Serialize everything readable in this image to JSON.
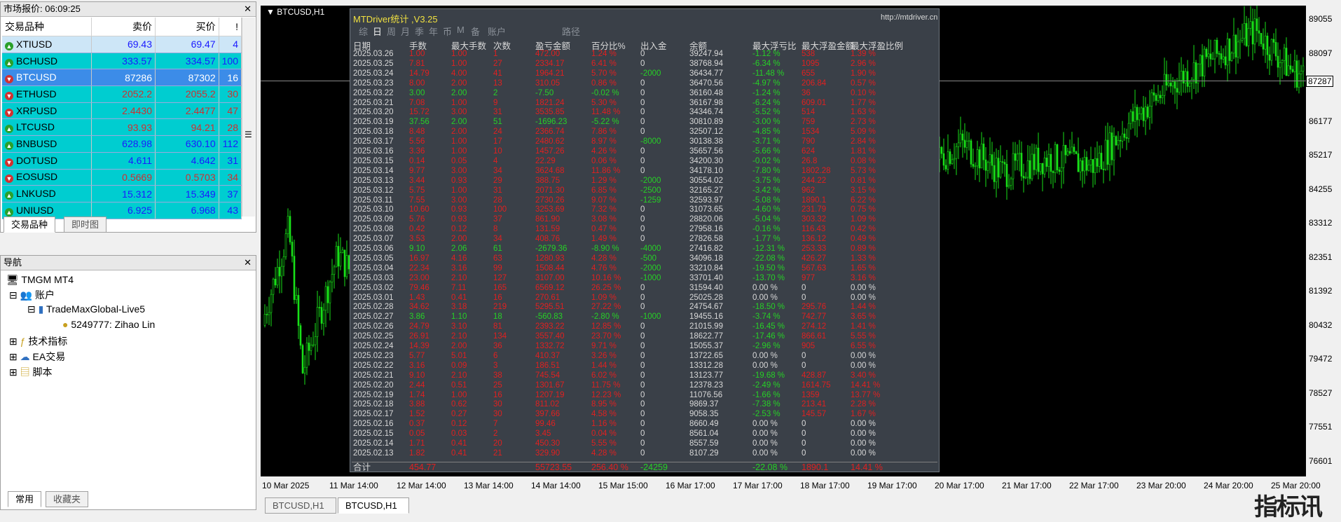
{
  "market_watch": {
    "title": "市场报价: 06:09:25",
    "headers": {
      "symbol": "交易品种",
      "bid": "卖价",
      "ask": "买价",
      "spread": "!"
    },
    "rows": [
      {
        "dir": "up",
        "symbol": "XTIUSD",
        "bid": "69.43",
        "ask": "69.47",
        "spread": "4",
        "color": "#1a1aff"
      },
      {
        "dir": "up",
        "symbol": "BCHUSD",
        "bid": "333.57",
        "ask": "334.57",
        "spread": "100",
        "color": "#1a1aff"
      },
      {
        "dir": "dn",
        "symbol": "BTCUSD",
        "bid": "87286",
        "ask": "87302",
        "spread": "16",
        "color": "#ffffff"
      },
      {
        "dir": "dn",
        "symbol": "ETHUSD",
        "bid": "2052.2",
        "ask": "2055.2",
        "spread": "30",
        "color": "#d03030"
      },
      {
        "dir": "dn",
        "symbol": "XRPUSD",
        "bid": "2.4430",
        "ask": "2.4477",
        "spread": "47",
        "color": "#d03030"
      },
      {
        "dir": "up",
        "symbol": "LTCUSD",
        "bid": "93.93",
        "ask": "94.21",
        "spread": "28",
        "color": "#d03030"
      },
      {
        "dir": "up",
        "symbol": "BNBUSD",
        "bid": "628.98",
        "ask": "630.10",
        "spread": "112",
        "color": "#1a1aff"
      },
      {
        "dir": "dn",
        "symbol": "DOTUSD",
        "bid": "4.611",
        "ask": "4.642",
        "spread": "31",
        "color": "#1a1aff"
      },
      {
        "dir": "dn",
        "symbol": "EOSUSD",
        "bid": "0.5669",
        "ask": "0.5703",
        "spread": "34",
        "color": "#d03030"
      },
      {
        "dir": "up",
        "symbol": "LNKUSD",
        "bid": "15.312",
        "ask": "15.349",
        "spread": "37",
        "color": "#1a1aff"
      },
      {
        "dir": "up",
        "symbol": "UNIUSD",
        "bid": "6.925",
        "ask": "6.968",
        "spread": "43",
        "color": "#1a1aff"
      }
    ],
    "tabs": [
      "交易品种",
      "即时图"
    ]
  },
  "navigator": {
    "title": "导航",
    "items": [
      "TMGM MT4",
      "账户",
      "TradeMaxGlobal-Live5",
      "5249777: Zihao Lin",
      "技术指标",
      "EA交易",
      "脚本"
    ],
    "tabs": [
      "常用",
      "收藏夹"
    ]
  },
  "chart": {
    "symbol_label": "BTCUSD,H1",
    "price_labels": [
      "89055",
      "88097",
      "87287",
      "86177",
      "85217",
      "84255",
      "83312",
      "82351",
      "81392",
      "80432",
      "79472",
      "78527",
      "77551",
      "76601"
    ],
    "time_labels": [
      "10 Mar 2025",
      "11 Mar 14:00",
      "12 Mar 14:00",
      "13 Mar 14:00",
      "14 Mar 14:00",
      "15 Mar 15:00",
      "16 Mar 17:00",
      "17 Mar 17:00",
      "18 Mar 17:00",
      "19 Mar 17:00",
      "20 Mar 17:00",
      "21 Mar 17:00",
      "22 Mar 17:00",
      "23 Mar 20:00",
      "24 Mar 20:00",
      "25 Mar 20:00"
    ],
    "tabs": [
      "BTCUSD,H1",
      "BTCUSD,H1"
    ]
  },
  "stats": {
    "title": "MTDriver统计 ,V3.25",
    "url": "http://mtdriver.cn",
    "tabs": [
      "综",
      "日",
      "周",
      "月",
      "季",
      "年",
      "币",
      "M",
      "备",
      "账户",
      "路径"
    ],
    "headers": [
      "日期",
      "手数",
      "最大手数",
      "次数",
      "盈亏金额",
      "百分比%",
      "出入金",
      "余额",
      "最大浮亏比",
      "最大浮盈金额",
      "最大浮盈比例"
    ],
    "rows": [
      [
        "2025.03.26",
        "1.00",
        "1.00",
        "1",
        "472.00",
        "1.24 %",
        "0",
        "39247.94",
        "-1.12 %",
        "538",
        "1.39 %"
      ],
      [
        "2025.03.25",
        "7.81",
        "1.00",
        "27",
        "2334.17",
        "6.41 %",
        "0",
        "38768.94",
        "-6.34 %",
        "1095",
        "2.96 %"
      ],
      [
        "2025.03.24",
        "14.79",
        "4.00",
        "41",
        "1964.21",
        "5.70 %",
        "-2000",
        "36434.77",
        "-11.48 %",
        "655",
        "1.90 %"
      ],
      [
        "2025.03.23",
        "8.00",
        "2.00",
        "13",
        "310.05",
        "0.86 %",
        "0",
        "36470.56",
        "-4.97 %",
        "206.84",
        "0.57 %"
      ],
      [
        "2025.03.22",
        "3.00",
        "2.00",
        "2",
        "-7.50",
        "-0.02 %",
        "0",
        "36160.48",
        "-1.24 %",
        "36",
        "0.10 %"
      ],
      [
        "2025.03.21",
        "7.08",
        "1.00",
        "9",
        "1821.24",
        "5.30 %",
        "0",
        "36167.98",
        "-6.24 %",
        "609.01",
        "1.77 %"
      ],
      [
        "2025.03.20",
        "15.72",
        "3.00",
        "31",
        "3535.85",
        "11.48 %",
        "0",
        "34346.74",
        "-5.52 %",
        "514",
        "1.63 %"
      ],
      [
        "2025.03.19",
        "37.56",
        "2.00",
        "51",
        "-1696.23",
        "-5.22 %",
        "0",
        "30810.89",
        "-3.00 %",
        "759",
        "2.73 %"
      ],
      [
        "2025.03.18",
        "8.48",
        "2.00",
        "24",
        "2366.74",
        "7.86 %",
        "0",
        "32507.12",
        "-4.85 %",
        "1534",
        "5.09 %"
      ],
      [
        "2025.03.17",
        "5.56",
        "1.00",
        "17",
        "2480.62",
        "8.97 %",
        "-8000",
        "30138.38",
        "-3.71 %",
        "790",
        "2.84 %"
      ],
      [
        "2025.03.16",
        "3.36",
        "1.00",
        "10",
        "1457.26",
        "4.26 %",
        "0",
        "35657.56",
        "-5.66 %",
        "624",
        "1.81 %"
      ],
      [
        "2025.03.15",
        "0.14",
        "0.05",
        "4",
        "22.29",
        "0.06 %",
        "0",
        "34200.30",
        "-0.02 %",
        "26.8",
        "0.08 %"
      ],
      [
        "2025.03.14",
        "9.77",
        "3.00",
        "34",
        "3624.68",
        "11.86 %",
        "0",
        "34178.10",
        "-7.80 %",
        "1802.28",
        "5.73 %"
      ],
      [
        "2025.03.13",
        "3.44",
        "0.93",
        "29",
        "388.75",
        "1.29 %",
        "-2000",
        "30554.02",
        "-3.75 %",
        "244.22",
        "0.81 %"
      ],
      [
        "2025.03.12",
        "5.75",
        "1.00",
        "31",
        "2071.30",
        "6.85 %",
        "-2500",
        "32165.27",
        "-3.42 %",
        "962",
        "3.15 %"
      ],
      [
        "2025.03.11",
        "7.55",
        "3.00",
        "28",
        "2730.26",
        "9.07 %",
        "-1259",
        "32593.97",
        "-5.08 %",
        "1890.1",
        "6.22 %"
      ],
      [
        "2025.03.10",
        "10.60",
        "0.93",
        "100",
        "3253.69",
        "7.32 %",
        "0",
        "31073.65",
        "-4.60 %",
        "231.79",
        "0.75 %"
      ],
      [
        "2025.03.09",
        "5.76",
        "0.93",
        "37",
        "861.90",
        "3.08 %",
        "0",
        "28820.06",
        "-5.04 %",
        "303.32",
        "1.09 %"
      ],
      [
        "2025.03.08",
        "0.42",
        "0.12",
        "8",
        "131.59",
        "0.47 %",
        "0",
        "27958.16",
        "-0.16 %",
        "116.43",
        "0.42 %"
      ],
      [
        "2025.03.07",
        "3.53",
        "2.00",
        "34",
        "408.76",
        "1.49 %",
        "0",
        "27826.58",
        "-1.77 %",
        "136.12",
        "0.49 %"
      ],
      [
        "2025.03.06",
        "9.10",
        "2.06",
        "61",
        "-2679.36",
        "-8.90 %",
        "-4000",
        "27416.82",
        "-12.31 %",
        "253.33",
        "0.89 %"
      ],
      [
        "2025.03.05",
        "16.97",
        "4.16",
        "63",
        "1280.93",
        "4.28 %",
        "-500",
        "34096.18",
        "-22.08 %",
        "426.27",
        "1.33 %"
      ],
      [
        "2025.03.04",
        "22.34",
        "3.16",
        "99",
        "1508.44",
        "4.76 %",
        "-2000",
        "33210.84",
        "-19.50 %",
        "567.63",
        "1.65 %"
      ],
      [
        "2025.03.03",
        "23.00",
        "2.10",
        "127",
        "3107.00",
        "10.16 %",
        "-1000",
        "33701.40",
        "-13.70 %",
        "977",
        "3.16 %"
      ],
      [
        "2025.03.02",
        "79.46",
        "7.11",
        "165",
        "6569.12",
        "26.25 %",
        "0",
        "31594.40",
        "0.00 %",
        "0",
        "0.00 %"
      ],
      [
        "2025.03.01",
        "1.43",
        "0.41",
        "16",
        "270.61",
        "1.09 %",
        "0",
        "25025.28",
        "0.00 %",
        "0",
        "0.00 %"
      ],
      [
        "2025.02.28",
        "34.62",
        "3.18",
        "219",
        "5295.51",
        "27.22 %",
        "0",
        "24754.67",
        "-18.50 %",
        "295.76",
        "1.44 %"
      ],
      [
        "2025.02.27",
        "3.86",
        "1.10",
        "18",
        "-560.83",
        "-2.80 %",
        "-1000",
        "19455.16",
        "-3.74 %",
        "742.77",
        "3.65 %"
      ],
      [
        "2025.02.26",
        "24.79",
        "3.10",
        "81",
        "2393.22",
        "12.85 %",
        "0",
        "21015.99",
        "-16.45 %",
        "274.12",
        "1.41 %"
      ],
      [
        "2025.02.25",
        "26.91",
        "2.10",
        "134",
        "3557.40",
        "23.70 %",
        "0",
        "18622.77",
        "-17.46 %",
        "866.61",
        "5.55 %"
      ],
      [
        "2025.02.24",
        "14.39",
        "2.00",
        "36",
        "1332.72",
        "9.71 %",
        "0",
        "15055.37",
        "-2.96 %",
        "905",
        "6.55 %"
      ],
      [
        "2025.02.23",
        "5.77",
        "5.01",
        "6",
        "410.37",
        "3.26 %",
        "0",
        "13722.65",
        "0.00 %",
        "0",
        "0.00 %"
      ],
      [
        "2025.02.22",
        "3.16",
        "0.09",
        "3",
        "186.51",
        "1.44 %",
        "0",
        "13312.28",
        "0.00 %",
        "0",
        "0.00 %"
      ],
      [
        "2025.02.21",
        "9.10",
        "2.10",
        "38",
        "745.54",
        "6.02 %",
        "0",
        "13123.77",
        "-19.68 %",
        "428.87",
        "3.40 %"
      ],
      [
        "2025.02.20",
        "2.44",
        "0.51",
        "25",
        "1301.67",
        "11.75 %",
        "0",
        "12378.23",
        "-2.49 %",
        "1614.75",
        "14.41 %"
      ],
      [
        "2025.02.19",
        "1.74",
        "1.00",
        "16",
        "1207.19",
        "12.23 %",
        "0",
        "11076.56",
        "-1.66 %",
        "1359",
        "13.77 %"
      ],
      [
        "2025.02.18",
        "3.88",
        "0.62",
        "30",
        "811.02",
        "8.95 %",
        "0",
        "9869.37",
        "-7.38 %",
        "213.41",
        "2.28 %"
      ],
      [
        "2025.02.17",
        "1.52",
        "0.27",
        "30",
        "397.66",
        "4.58 %",
        "0",
        "9058.35",
        "-2.53 %",
        "145.57",
        "1.67 %"
      ],
      [
        "2025.02.16",
        "0.37",
        "0.12",
        "7",
        "99.46",
        "1.16 %",
        "0",
        "8660.49",
        "0.00 %",
        "0",
        "0.00 %"
      ],
      [
        "2025.02.15",
        "0.05",
        "0.03",
        "2",
        "3.45",
        "0.04 %",
        "0",
        "8561.04",
        "0.00 %",
        "0",
        "0.00 %"
      ],
      [
        "2025.02.14",
        "1.71",
        "0.41",
        "20",
        "450.30",
        "5.55 %",
        "0",
        "8557.59",
        "0.00 %",
        "0",
        "0.00 %"
      ],
      [
        "2025.02.13",
        "1.82",
        "0.41",
        "21",
        "329.90",
        "4.28 %",
        "0",
        "8107.29",
        "0.00 %",
        "0",
        "0.00 %"
      ]
    ],
    "total": [
      "合计",
      "454.77",
      "",
      "",
      "55723.55",
      "256.40 %",
      "-24259",
      "",
      "-22.08 %",
      "1890.1",
      "14.41 %"
    ]
  },
  "watermark": "指标讯",
  "colors": {
    "bull": "#18e018",
    "chart_bg": "#000000",
    "profit_pos": "#e02020",
    "profit_neg": "#26d026",
    "text": "#d8d8d8"
  }
}
